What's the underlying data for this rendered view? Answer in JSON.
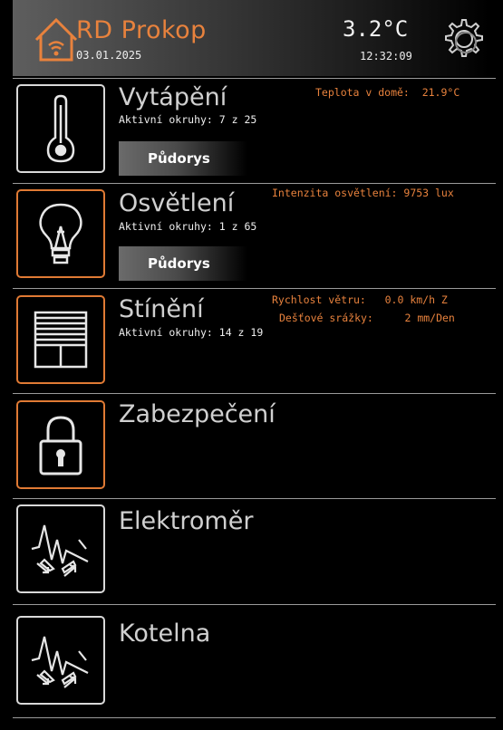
{
  "header": {
    "title": "RD Prokop",
    "date": "03.01.2025",
    "temperature": "3.2°C",
    "time": "12:32:09",
    "home_icon": "smart-home-icon",
    "settings_icon": "gear-icon"
  },
  "colors": {
    "accent": "#e8823d",
    "background": "#000000",
    "divider": "#9a9a9a"
  },
  "sections": {
    "heating": {
      "title": "Vytápění",
      "subtitle": "Aktivní okruhy: 7 z 25",
      "info_line1": "Teplota v domě:  21.9°C",
      "plan_button": "Půdorys",
      "icon": "thermometer-icon"
    },
    "lighting": {
      "title": "Osvětlení",
      "subtitle": "Aktivní okruhy: 1 z 65",
      "info_line1": "Intenzita osvětlení: 9753 lux",
      "plan_button": "Půdorys",
      "icon": "light-bulb-icon"
    },
    "shading": {
      "title": "Stínění",
      "subtitle": "Aktivní okruhy: 14 z 19",
      "info_line1": "Rychlost větru:   0.0 km/h Z",
      "info_line2": "Dešťové srážky:     2 mm/Den",
      "icon": "window-blind-icon"
    },
    "security": {
      "title": "Zabezpečení",
      "icon": "padlock-icon"
    },
    "energy_meter": {
      "title": "Elektroměr",
      "icon": "electricity-icon"
    },
    "boiler": {
      "title": "Kotelna",
      "icon": "electricity-icon"
    }
  }
}
